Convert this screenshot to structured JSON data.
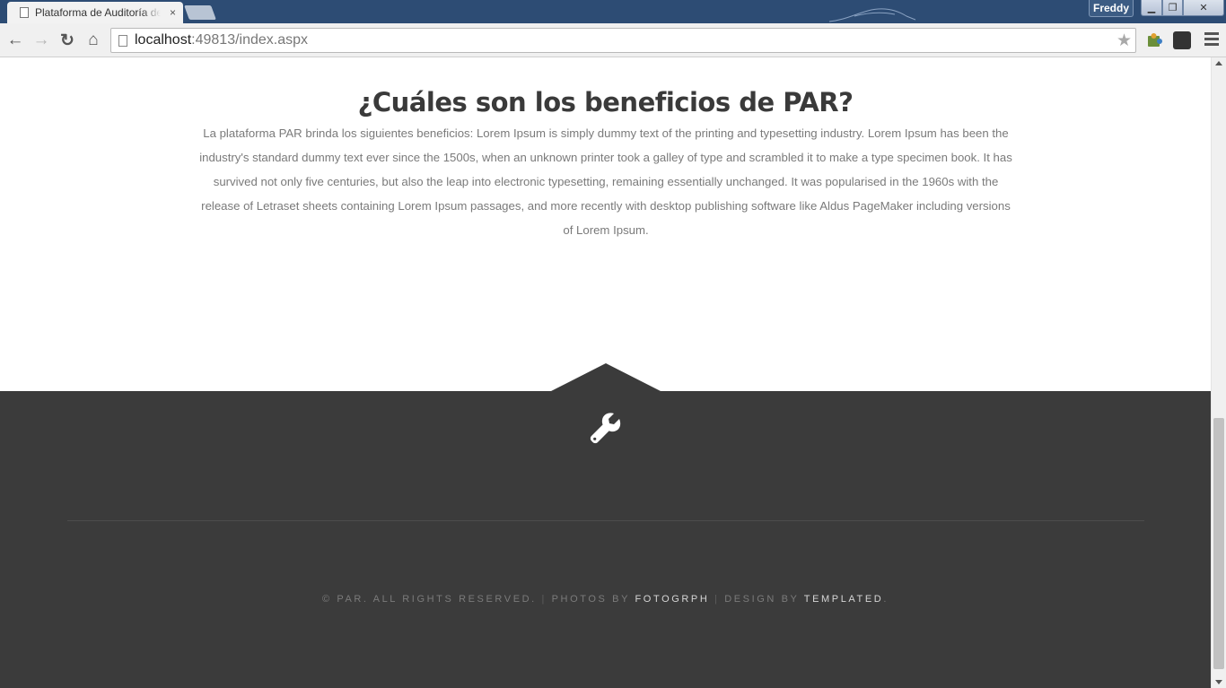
{
  "browser": {
    "tab_title": "Plataforma de Auditoría de",
    "tab_close": "×",
    "profile_name": "Freddy",
    "url_host": "localhost",
    "url_rest": ":49813/index.aspx",
    "win_min": "▁",
    "win_max": "❐",
    "win_close": "✕",
    "back_glyph": "←",
    "forward_glyph": "→",
    "reload_glyph": "↻",
    "home_glyph": "⌂",
    "star_glyph": "★"
  },
  "benefits": {
    "heading": "¿Cuáles son los beneficios de PAR?",
    "body": "La plataforma PAR brinda los siguientes beneficios: Lorem Ipsum is simply dummy text of the printing and typesetting industry. Lorem Ipsum has been the industry's standard dummy text ever since the 1500s, when an unknown printer took a galley of type and scrambled it to make a type specimen book. It has survived not only five centuries, but also the leap into electronic typesetting, remaining essentially unchanged. It was popularised in the 1960s with the release of Letraset sheets containing Lorem Ipsum passages, and more recently with desktop publishing software like Aldus PageMaker including versions of Lorem Ipsum."
  },
  "footer": {
    "icon": "wrench-icon",
    "copyright": "© PAR. ALL RIGHTS RESERVED.",
    "separator": " | ",
    "photos_by": "PHOTOS BY ",
    "photos_link": "FOTOGRPH",
    "design_by": "DESIGN BY ",
    "design_link": "TEMPLATED",
    "end": "."
  },
  "colors": {
    "footer_bg": "#3b3b3b",
    "heading": "#3a3a3a",
    "body_text": "#7a7a7a",
    "chrome_frame": "#2d4c74"
  }
}
